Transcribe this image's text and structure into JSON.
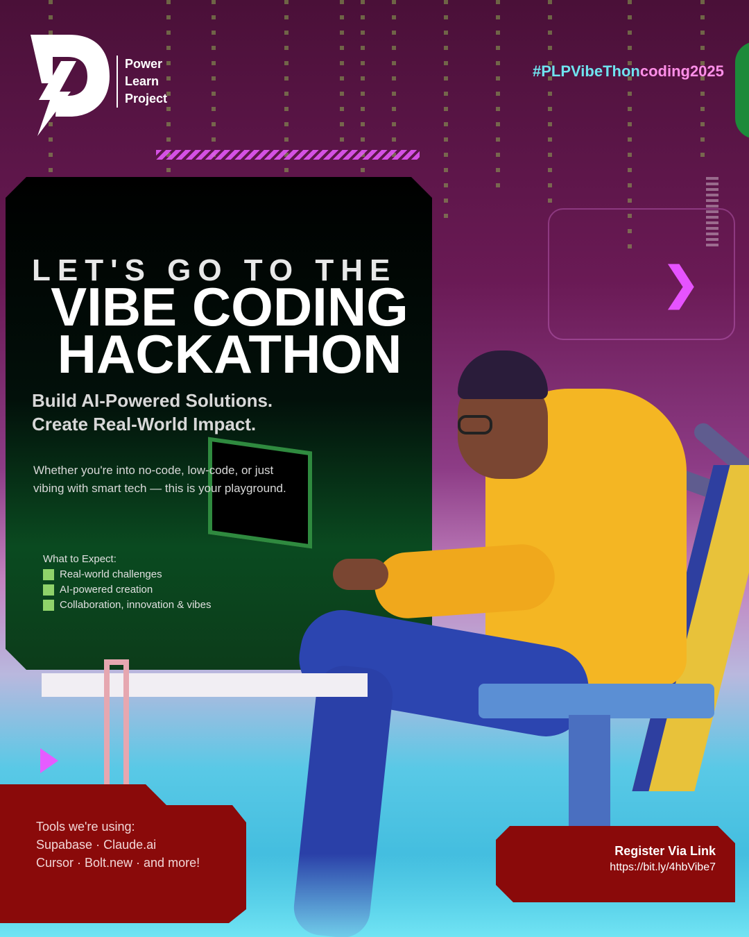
{
  "brand": {
    "logo_line1": "Power",
    "logo_line2": "Learn",
    "logo_line3": "Project"
  },
  "tag": {
    "part1": "#PLPVibeThon",
    "part2": "coding2025"
  },
  "hero": {
    "eyebrow": "LET'S GO TO THE",
    "headline_line1": "VIBE CODING",
    "headline_line2": "HACKATHON",
    "sub_line1": "Build AI-Powered Solutions.",
    "sub_line2": "Create Real-World Impact.",
    "body": "Whether you're into no-code, low-code, or just vibing with smart tech — this is your playground."
  },
  "expect": {
    "title": "What to Expect:",
    "items": [
      "Real-world challenges",
      "AI-powered creation",
      "Collaboration, innovation & vibes"
    ]
  },
  "tools": {
    "line1": "Tools we're using:",
    "line2": "Supabase · Claude.ai",
    "line3": "Cursor · Bolt.new · and more!"
  },
  "register": {
    "title": "Register Via Link",
    "url": "https://bit.ly/4hbVibe7"
  },
  "colors": {
    "accent_pink": "#e653ff",
    "accent_cyan": "#6fe3ef",
    "panel_green": "#0a4a20",
    "box_red": "#8a0a0a",
    "hoodie_yellow": "#f4b623"
  },
  "icons": {
    "logo": "power-learn-logo-icon",
    "chevron": "chevron-right-icon",
    "check": "check-square-icon",
    "triangle": "play-triangle-icon"
  }
}
